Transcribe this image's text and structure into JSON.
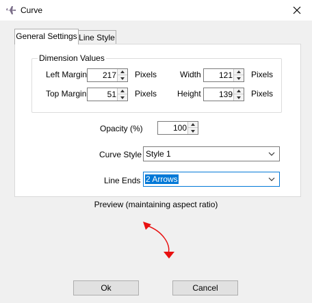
{
  "window": {
    "title": "Curve",
    "icon": "airplane-icon"
  },
  "tabs": [
    {
      "label": "General Settings",
      "active": true
    },
    {
      "label": "Line Style",
      "active": false
    }
  ],
  "dimension": {
    "legend": "Dimension Values",
    "left_margin": {
      "label": "Left Margin",
      "value": "217",
      "unit": "Pixels"
    },
    "top_margin": {
      "label": "Top Margin",
      "value": "51",
      "unit": "Pixels"
    },
    "width": {
      "label": "Width",
      "value": "121",
      "unit": "Pixels"
    },
    "height": {
      "label": "Height",
      "value": "139",
      "unit": "Pixels"
    }
  },
  "opacity": {
    "label": "Opacity (%)",
    "value": "100"
  },
  "curve_style": {
    "label": "Curve Style",
    "value": "Style 1"
  },
  "line_ends": {
    "label": "Line Ends",
    "value": "2 Arrows"
  },
  "preview": {
    "label": "Preview (maintaining aspect ratio)",
    "color": "#e81010"
  },
  "buttons": {
    "ok": "Ok",
    "cancel": "Cancel"
  }
}
